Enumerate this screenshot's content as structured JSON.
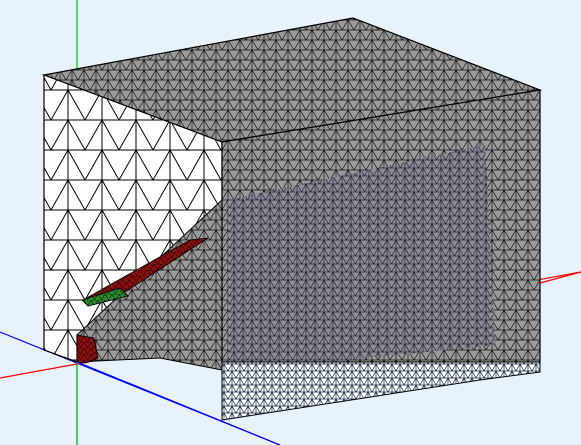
{
  "viewport": {
    "background": "#e8f2fc",
    "view": "3d-mesh-wireframe",
    "axes": {
      "x_color": "#ff0000",
      "y_color": "#00c000",
      "z_color": "#0000ff"
    },
    "colors": {
      "mesh_line": "#000000",
      "fill_gray": "#9a9a9a",
      "fill_gray_light": "#a8a8a8",
      "fill_white": "#ffffff",
      "fill_red": "#8b1010",
      "fill_green": "#2e8b2e",
      "dense_mesh": "#242b40"
    }
  }
}
